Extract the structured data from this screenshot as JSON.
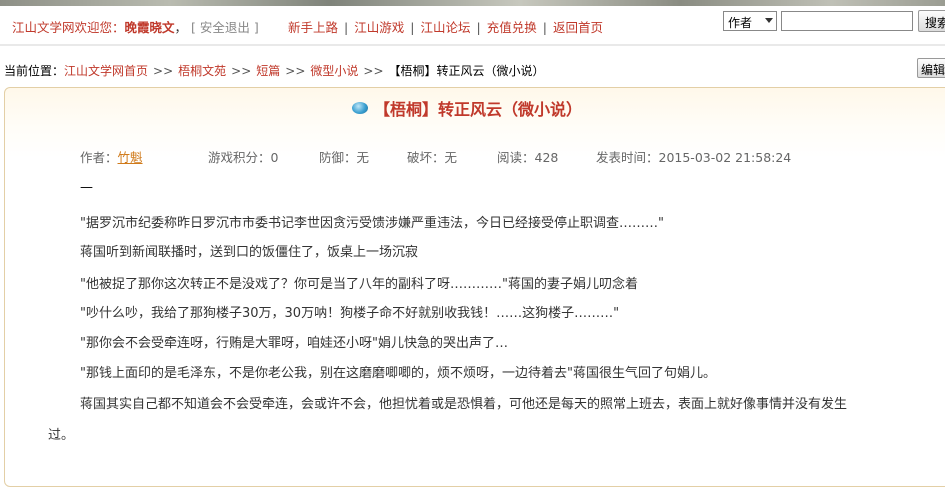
{
  "header": {
    "welcome_prefix": "江山文学网欢迎您：",
    "username": "晚霞晓文",
    "comma": "，",
    "logout": "[ 安全退出 ]",
    "nav": [
      "新手上路",
      "江山游戏",
      "江山论坛",
      "充值兑换",
      "返回首页"
    ],
    "search_select_value": "作者",
    "search_value": "",
    "search_button": "搜索"
  },
  "breadcrumb": {
    "label": "当前位置：",
    "items": [
      "江山文学网首页",
      "梧桐文苑",
      "短篇",
      "微型小说"
    ],
    "separator": ">>",
    "current": "【梧桐】转正风云（微小说）",
    "edit_button": "编辑"
  },
  "article": {
    "title": "【梧桐】转正风云（微小说）",
    "meta": {
      "author_label": "作者：",
      "author": "竹魁",
      "game_points": "游戏积分：0",
      "defense": "防御：无",
      "damage": "破坏：无",
      "reads": "阅读：428",
      "published": "发表时间：2015-03-02 21:58:24"
    },
    "dash": "—",
    "paragraphs": [
      "\"据罗沉市纪委称昨日罗沉市市委书记李世因贪污受馈涉嫌严重违法，今日已经接受停止职调查………\"",
      "蒋国听到新闻联播时，送到口的饭僵住了，饭桌上一场沉寂",
      "\"他被捉了那你这次转正不是没戏了？你可是当了八年的副科了呀…………\"蒋国的妻子娟儿叨念着",
      "\"吵什么吵，我给了那狗楼子30万，30万呐！狗楼子命不好就别收我钱！……这狗楼子………\"",
      "\"那你会不会受牵连呀，行贿是大罪呀，咱娃还小呀\"娟儿快急的哭出声了…",
      "\"那钱上面印的是毛泽东，不是你老公我，别在这磨磨唧唧的，烦不烦呀，一边待着去\"蒋国很生气回了句娟儿。",
      "蒋国其实自己都不知道会不会受牵连，会或许不会，他担忧着或是恐惧着，可他还是每天的照常上班去，表面上就好像事情并没有发生",
      "过。"
    ]
  }
}
